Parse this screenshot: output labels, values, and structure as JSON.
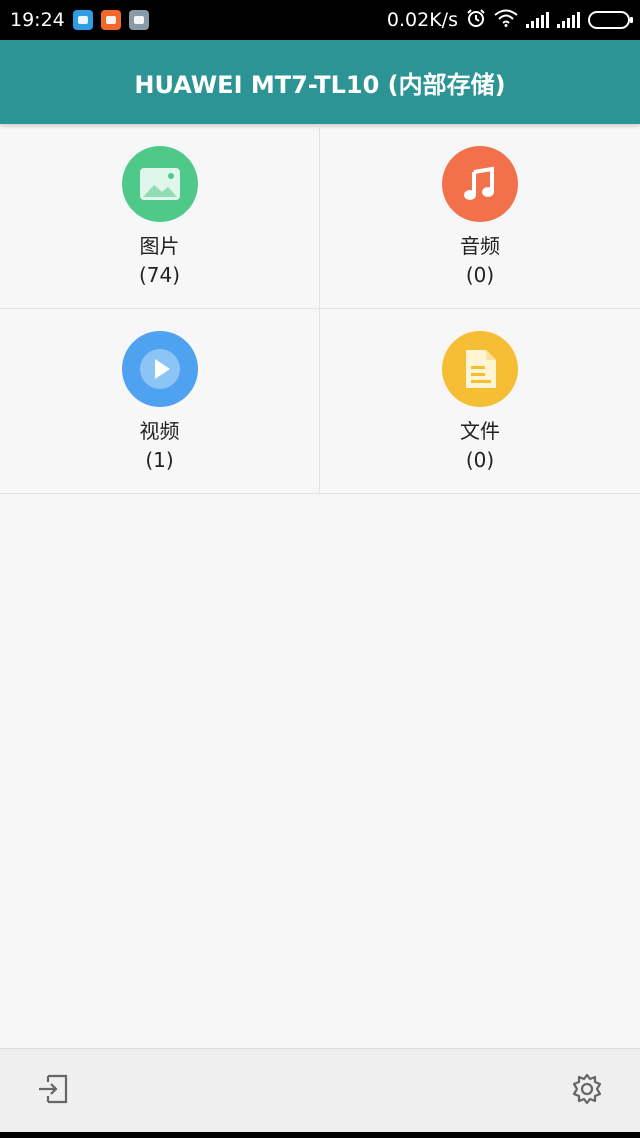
{
  "status_bar": {
    "time": "19:24",
    "net_speed": "0.02K/s",
    "app_icons": [
      "messenger-app-icon",
      "video-app-icon",
      "calculator-app-icon"
    ],
    "icons": [
      "alarm-icon",
      "wifi-icon",
      "signal-icon",
      "signal-icon",
      "battery-icon"
    ]
  },
  "app_bar": {
    "title": "HUAWEI MT7-TL10 (内部存储)"
  },
  "categories": [
    {
      "label": "图片",
      "count": "(74)",
      "icon": "image-icon",
      "color": "#4ec98a"
    },
    {
      "label": "音频",
      "count": "(0)",
      "icon": "music-note-icon",
      "color": "#f2704a"
    },
    {
      "label": "视频",
      "count": "(1)",
      "icon": "play-icon",
      "color": "#4ea2ef"
    },
    {
      "label": "文件",
      "count": "(0)",
      "icon": "document-icon",
      "color": "#f6be35"
    }
  ],
  "bottom_bar": {
    "left_icon": "exit-icon",
    "right_icon": "gear-icon"
  },
  "colors": {
    "accent": "#2c9494",
    "background": "#f7f7f7"
  }
}
